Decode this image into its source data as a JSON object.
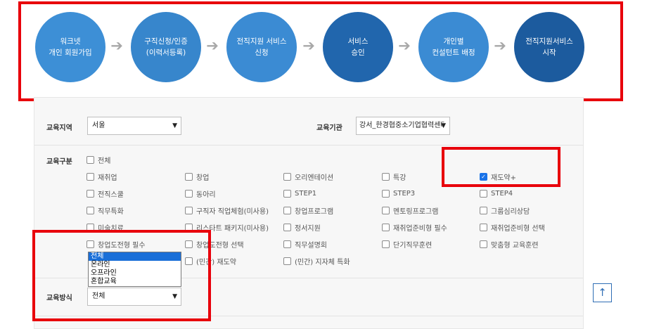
{
  "steps": [
    {
      "line1": "워크넷",
      "line2": "개인 회원가입",
      "color": "#3d8fd6"
    },
    {
      "line1": "구직신청/인증",
      "line2": "(이력서등록)",
      "color": "#3786cc"
    },
    {
      "line1": "전직지원 서비스",
      "line2": "신청",
      "color": "#3b8bd3"
    },
    {
      "line1": "서비스",
      "line2": "승인",
      "color": "#2166ad"
    },
    {
      "line1": "개인별",
      "line2": "컨설턴트 배정",
      "color": "#3b8bd3"
    },
    {
      "line1": "전직지원서비스",
      "line2": "시작",
      "color": "#1c5b9e"
    }
  ],
  "arrow_glyph": "➔",
  "filters": {
    "region_label": "교육지역",
    "region_value": "서울",
    "org_label": "교육기관",
    "org_value": "강서_한경협중소기업협력센터",
    "category_label": "교육구분",
    "method_label": "교육방식",
    "method_value": "전체"
  },
  "categories": {
    "all": "전체",
    "grid": [
      [
        "재취업",
        "창업",
        "오리엔테이션",
        "특강",
        "재도약+"
      ],
      [
        "전직스쿨",
        "동아리",
        "STEP1",
        "STEP3",
        "STEP4"
      ],
      [
        "직무특화",
        "구직자 직업체험(미사용)",
        "창업프로그램",
        "멘토링프로그램",
        "그룹심리상담"
      ],
      [
        "미술치료",
        "리스타트 패키지(미사용)",
        "정서지원",
        "재취업준비형 필수",
        "재취업준비형 선택"
      ],
      [
        "창업도전형 필수",
        "창업도전형 선택",
        "직무설명회",
        "단기직무훈련",
        "맞춤형 교육훈련"
      ],
      [
        "",
        "(민간) 재도약",
        "(민간) 지자체 특화",
        "",
        ""
      ]
    ],
    "checked": "재도약+"
  },
  "method_options": [
    "전체",
    "온라인",
    "오프라인",
    "혼합교육"
  ],
  "top_button_glyph": "↑",
  "colors": {
    "highlight": "#e8000b",
    "checkbox_checked": "#1a73e8",
    "top_button": "#2f6eb5"
  }
}
